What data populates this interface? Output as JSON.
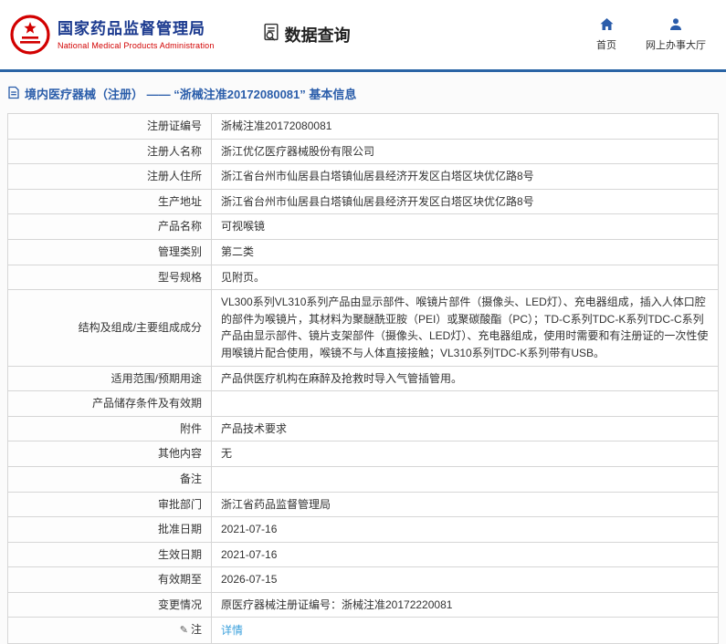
{
  "colors": {
    "brand_blue": "#1b3a8f",
    "brand_red": "#d20000",
    "divider_blue": "#2a64a5",
    "title_blue": "#2a5daa",
    "link_blue": "#3aa0dc"
  },
  "header": {
    "org_name": "国家药品监督管理局",
    "org_name_en": "National Medical Products Administration",
    "data_query_label": "数据查询",
    "nav_home": "首页",
    "nav_hall": "网上办事大厅"
  },
  "page": {
    "title": "境内医疗器械（注册） —— “浙械注准20172080081” 基本信息"
  },
  "table": {
    "rows": [
      {
        "label": "注册证编号",
        "value": "浙械注准20172080081"
      },
      {
        "label": "注册人名称",
        "value": "浙江优亿医疗器械股份有限公司"
      },
      {
        "label": "注册人住所",
        "value": "浙江省台州市仙居县白塔镇仙居县经济开发区白塔区块优亿路8号"
      },
      {
        "label": "生产地址",
        "value": "浙江省台州市仙居县白塔镇仙居县经济开发区白塔区块优亿路8号"
      },
      {
        "label": "产品名称",
        "value": "可视喉镜"
      },
      {
        "label": "管理类别",
        "value": "第二类"
      },
      {
        "label": "型号规格",
        "value": "见附页。"
      },
      {
        "label": "结构及组成/主要组成成分",
        "value": "VL300系列VL310系列产品由显示部件、喉镜片部件（摄像头、LED灯）、充电器组成，插入人体口腔的部件为喉镜片，其材料为聚醚酰亚胺（PEI）或聚碳酸酯（PC）；TD-C系列TDC-K系列TDC-C系列产品由显示部件、镜片支架部件（摄像头、LED灯）、充电器组成，使用时需要和有注册证的一次性使用喉镜片配合使用，喉镜不与人体直接接触；VL310系列TDC-K系列带有USB。"
      },
      {
        "label": "适用范围/预期用途",
        "value": "产品供医疗机构在麻醉及抢救时导入气管插管用。"
      },
      {
        "label": "产品储存条件及有效期",
        "value": ""
      },
      {
        "label": "附件",
        "value": "产品技术要求"
      },
      {
        "label": "其他内容",
        "value": "无"
      },
      {
        "label": "备注",
        "value": ""
      },
      {
        "label": "审批部门",
        "value": "浙江省药品监督管理局"
      },
      {
        "label": "批准日期",
        "value": "2021-07-16"
      },
      {
        "label": "生效日期",
        "value": "2021-07-16"
      },
      {
        "label": "有效期至",
        "value": "2026-07-15"
      },
      {
        "label": "变更情况",
        "value": "原医疗器械注册证编号：浙械注准20172220081"
      },
      {
        "label": "注",
        "label_icon": "note-icon",
        "value": "详情",
        "link": true
      }
    ]
  }
}
